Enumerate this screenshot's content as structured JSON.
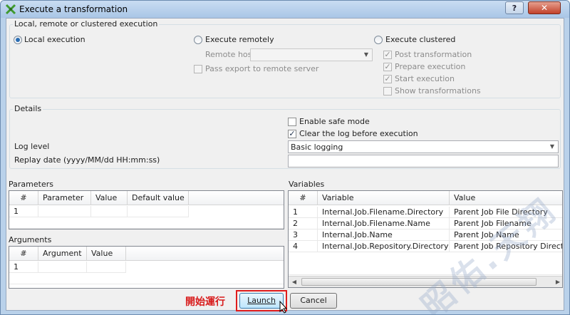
{
  "window": {
    "title": "Execute a transformation",
    "help_label": "?",
    "close_label": "✕"
  },
  "execution": {
    "legend": "Local, remote or clustered execution",
    "local_label": "Local execution",
    "remote_label": "Execute remotely",
    "remote_host_label": "Remote host",
    "remote_host_value": "",
    "pass_export_label": "Pass export to remote server",
    "clustered_label": "Execute clustered",
    "post_transformation_label": "Post transformation",
    "prepare_execution_label": "Prepare execution",
    "start_execution_label": "Start execution",
    "show_transformations_label": "Show transformations"
  },
  "details": {
    "legend": "Details",
    "safe_mode_label": "Enable safe mode",
    "clear_log_label": "Clear the log before execution",
    "log_level_label": "Log level",
    "log_level_value": "Basic logging",
    "replay_date_label": "Replay date (yyyy/MM/dd HH:mm:ss)",
    "replay_date_value": ""
  },
  "parameters": {
    "title": "Parameters",
    "columns": [
      "#",
      "Parameter",
      "Value",
      "Default value"
    ],
    "rows": [
      [
        "1",
        "",
        "",
        ""
      ]
    ]
  },
  "arguments": {
    "title": "Arguments",
    "columns": [
      "#",
      "Argument",
      "Value"
    ],
    "rows": [
      [
        "1",
        "",
        ""
      ]
    ]
  },
  "variables": {
    "title": "Variables",
    "columns": [
      "#",
      "Variable",
      "Value"
    ],
    "rows": [
      [
        "1",
        "Internal.Job.Filename.Directory",
        "Parent Job File Directory"
      ],
      [
        "2",
        "Internal.Job.Filename.Name",
        "Parent Job Filename"
      ],
      [
        "3",
        "Internal.Job.Name",
        "Parent Job Name"
      ],
      [
        "4",
        "Internal.Job.Repository.Directory",
        "Parent Job Repository Directory"
      ]
    ]
  },
  "buttons": {
    "launch_label": "Launch",
    "cancel_label": "Cancel"
  },
  "annotation": {
    "text": "開始運行",
    "color": "#d81b1b"
  },
  "watermark": {
    "text": "昭佑.天翔"
  },
  "colors": {
    "accent": "#2a6db3",
    "title_bar": "#b9d1ea"
  }
}
